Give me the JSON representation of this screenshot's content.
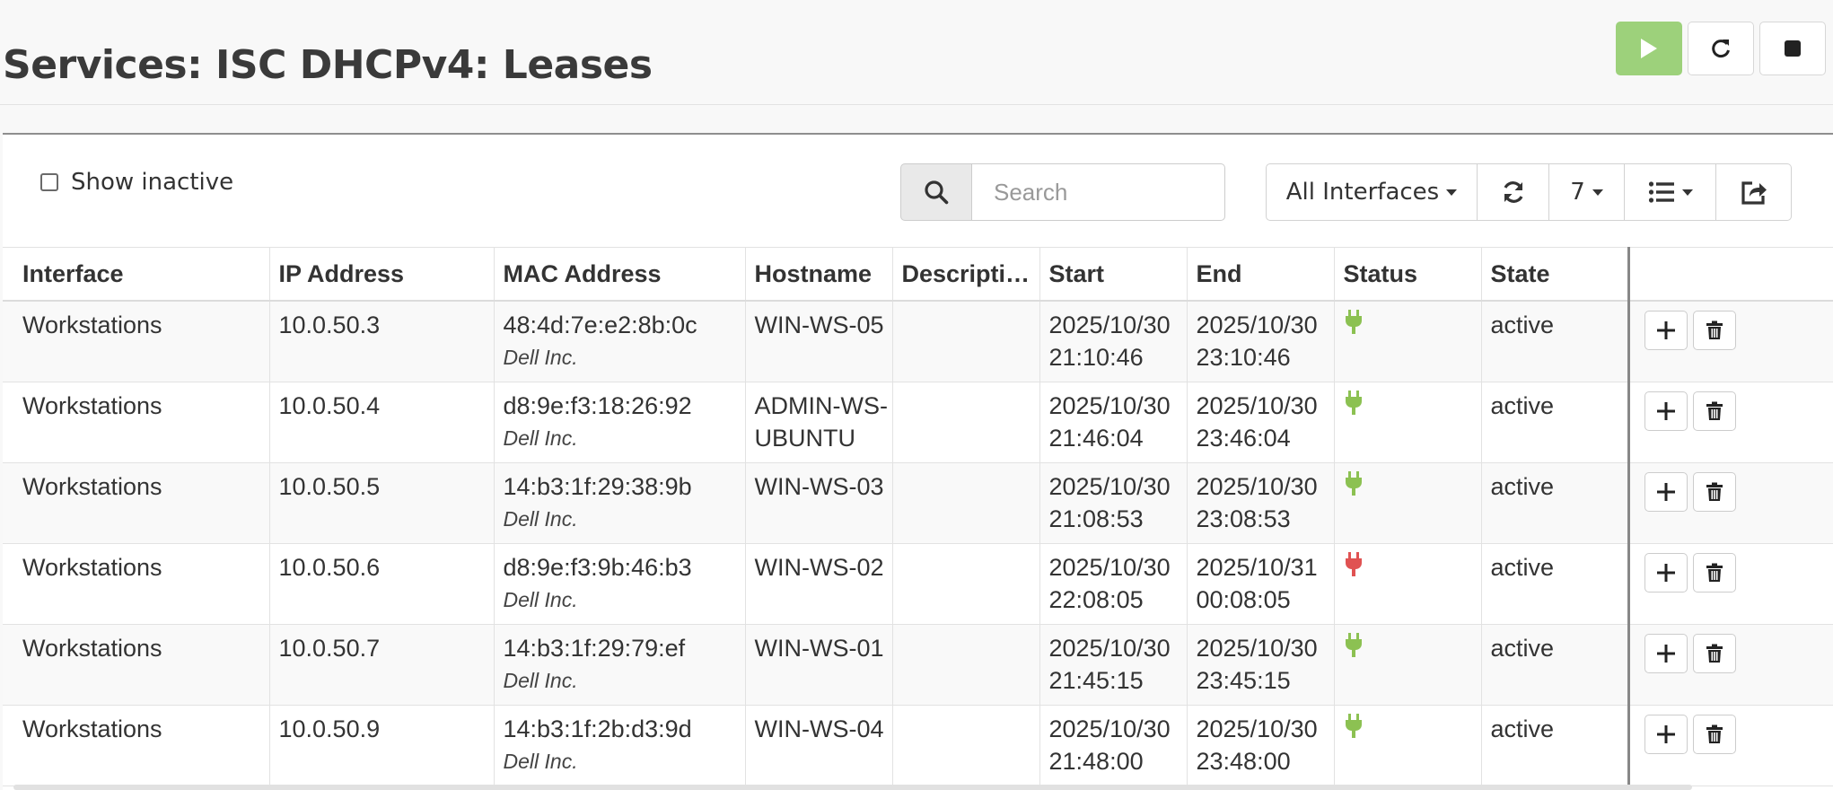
{
  "page": {
    "title": "Services: ISC DHCPv4: Leases"
  },
  "colors": {
    "accent_play": "#9dd17b",
    "status_ok": "#8cc152",
    "status_bad": "#e05252"
  },
  "icons": {
    "play": "play-icon",
    "reload": "reload-icon",
    "stop": "stop-icon",
    "search": "search-icon",
    "refresh": "refresh-icon",
    "columns": "list-icon",
    "export": "export-icon",
    "add": "plus-icon",
    "delete": "trash-icon",
    "status": "plug-icon"
  },
  "filters": {
    "show_inactive_label": "Show inactive",
    "search_placeholder": "Search",
    "search_value": "",
    "interfaces_label": "All Interfaces",
    "page_size": "7"
  },
  "table": {
    "columns": [
      "Interface",
      "IP Address",
      "MAC Address",
      "Hostname",
      "Descripti…",
      "Start",
      "End",
      "Status",
      "State"
    ],
    "rows": [
      {
        "interface": "Workstations",
        "ip": "10.0.50.3",
        "mac": "48:4d:7e:e2:8b:0c",
        "vendor": "Dell Inc.",
        "hostname": "WIN-WS-05",
        "description": "",
        "start_date": "2025/10/30",
        "start_time": "21:10:46",
        "end_date": "2025/10/30",
        "end_time": "23:10:46",
        "status": "online",
        "state": "active"
      },
      {
        "interface": "Workstations",
        "ip": "10.0.50.4",
        "mac": "d8:9e:f3:18:26:92",
        "vendor": "Dell Inc.",
        "hostname": "ADMIN-WS-UBUNTU",
        "hostname_line1": "ADMIN-WS-",
        "hostname_line2": "UBUNTU",
        "description": "",
        "start_date": "2025/10/30",
        "start_time": "21:46:04",
        "end_date": "2025/10/30",
        "end_time": "23:46:04",
        "status": "online",
        "state": "active"
      },
      {
        "interface": "Workstations",
        "ip": "10.0.50.5",
        "mac": "14:b3:1f:29:38:9b",
        "vendor": "Dell Inc.",
        "hostname": "WIN-WS-03",
        "description": "",
        "start_date": "2025/10/30",
        "start_time": "21:08:53",
        "end_date": "2025/10/30",
        "end_time": "23:08:53",
        "status": "online",
        "state": "active"
      },
      {
        "interface": "Workstations",
        "ip": "10.0.50.6",
        "mac": "d8:9e:f3:9b:46:b3",
        "vendor": "Dell Inc.",
        "hostname": "WIN-WS-02",
        "description": "",
        "start_date": "2025/10/30",
        "start_time": "22:08:05",
        "end_date": "2025/10/31",
        "end_time": "00:08:05",
        "status": "offline",
        "state": "active"
      },
      {
        "interface": "Workstations",
        "ip": "10.0.50.7",
        "mac": "14:b3:1f:29:79:ef",
        "vendor": "Dell Inc.",
        "hostname": "WIN-WS-01",
        "description": "",
        "start_date": "2025/10/30",
        "start_time": "21:45:15",
        "end_date": "2025/10/30",
        "end_time": "23:45:15",
        "status": "online",
        "state": "active"
      },
      {
        "interface": "Workstations",
        "ip": "10.0.50.9",
        "mac": "14:b3:1f:2b:d3:9d",
        "vendor": "Dell Inc.",
        "hostname": "WIN-WS-04",
        "description": "",
        "start_date": "2025/10/30",
        "start_time": "21:48:00",
        "end_date": "2025/10/30",
        "end_time": "23:48:00",
        "status": "online",
        "state": "active"
      }
    ]
  }
}
